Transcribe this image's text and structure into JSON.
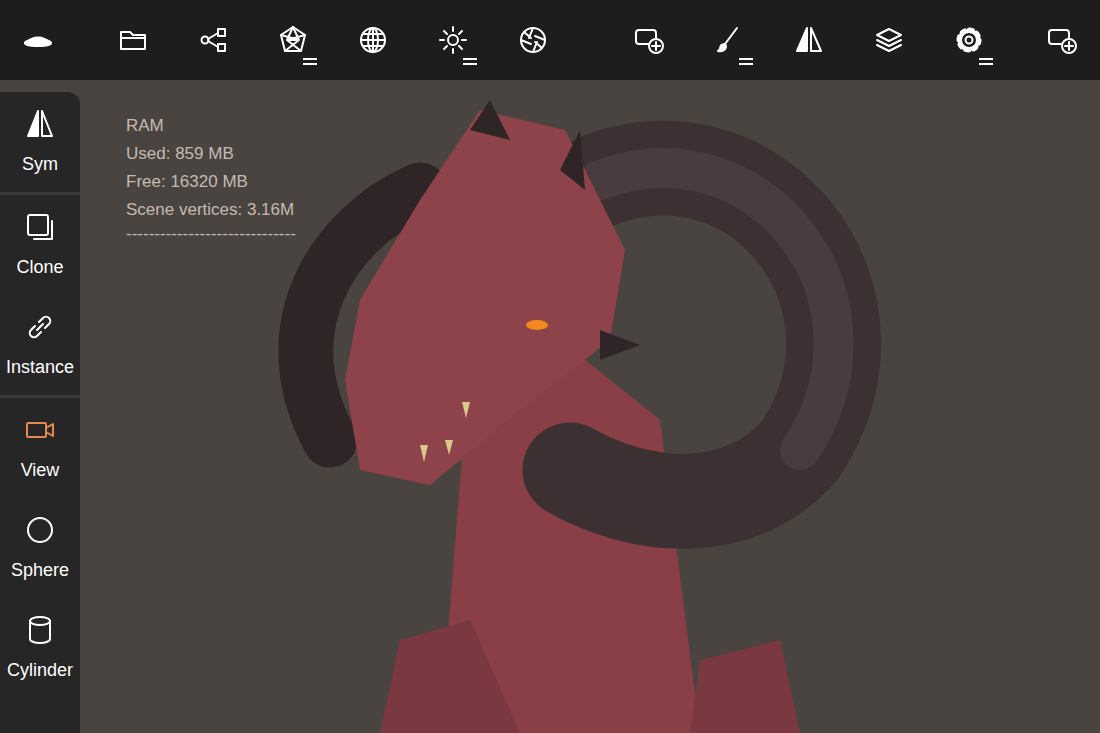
{
  "top_bar": {
    "items": [
      {
        "has_menu": false
      },
      {
        "has_menu": false
      },
      {
        "has_menu": false
      },
      {
        "has_menu": true
      },
      {
        "has_menu": false
      },
      {
        "has_menu": true
      },
      {
        "has_menu": false
      },
      {
        "has_menu": false
      },
      {
        "has_menu": true
      },
      {
        "has_menu": false
      },
      {
        "has_menu": false
      },
      {
        "has_menu": true
      },
      {
        "has_menu": false
      }
    ]
  },
  "sidebar": {
    "groups": [
      [
        {
          "label": "Sym",
          "selected": false
        }
      ],
      [
        {
          "label": "Clone",
          "selected": false
        },
        {
          "label": "Instance",
          "selected": false
        }
      ],
      [
        {
          "label": "View",
          "selected": true
        },
        {
          "label": "Sphere",
          "selected": false
        },
        {
          "label": "Cylinder",
          "selected": false
        }
      ]
    ]
  },
  "stats": {
    "title": "RAM",
    "lines": [
      "Used: 859 MB",
      "Free: 16320 MB",
      "Scene vertices: 3.16M"
    ],
    "separator": "------------------------------"
  }
}
